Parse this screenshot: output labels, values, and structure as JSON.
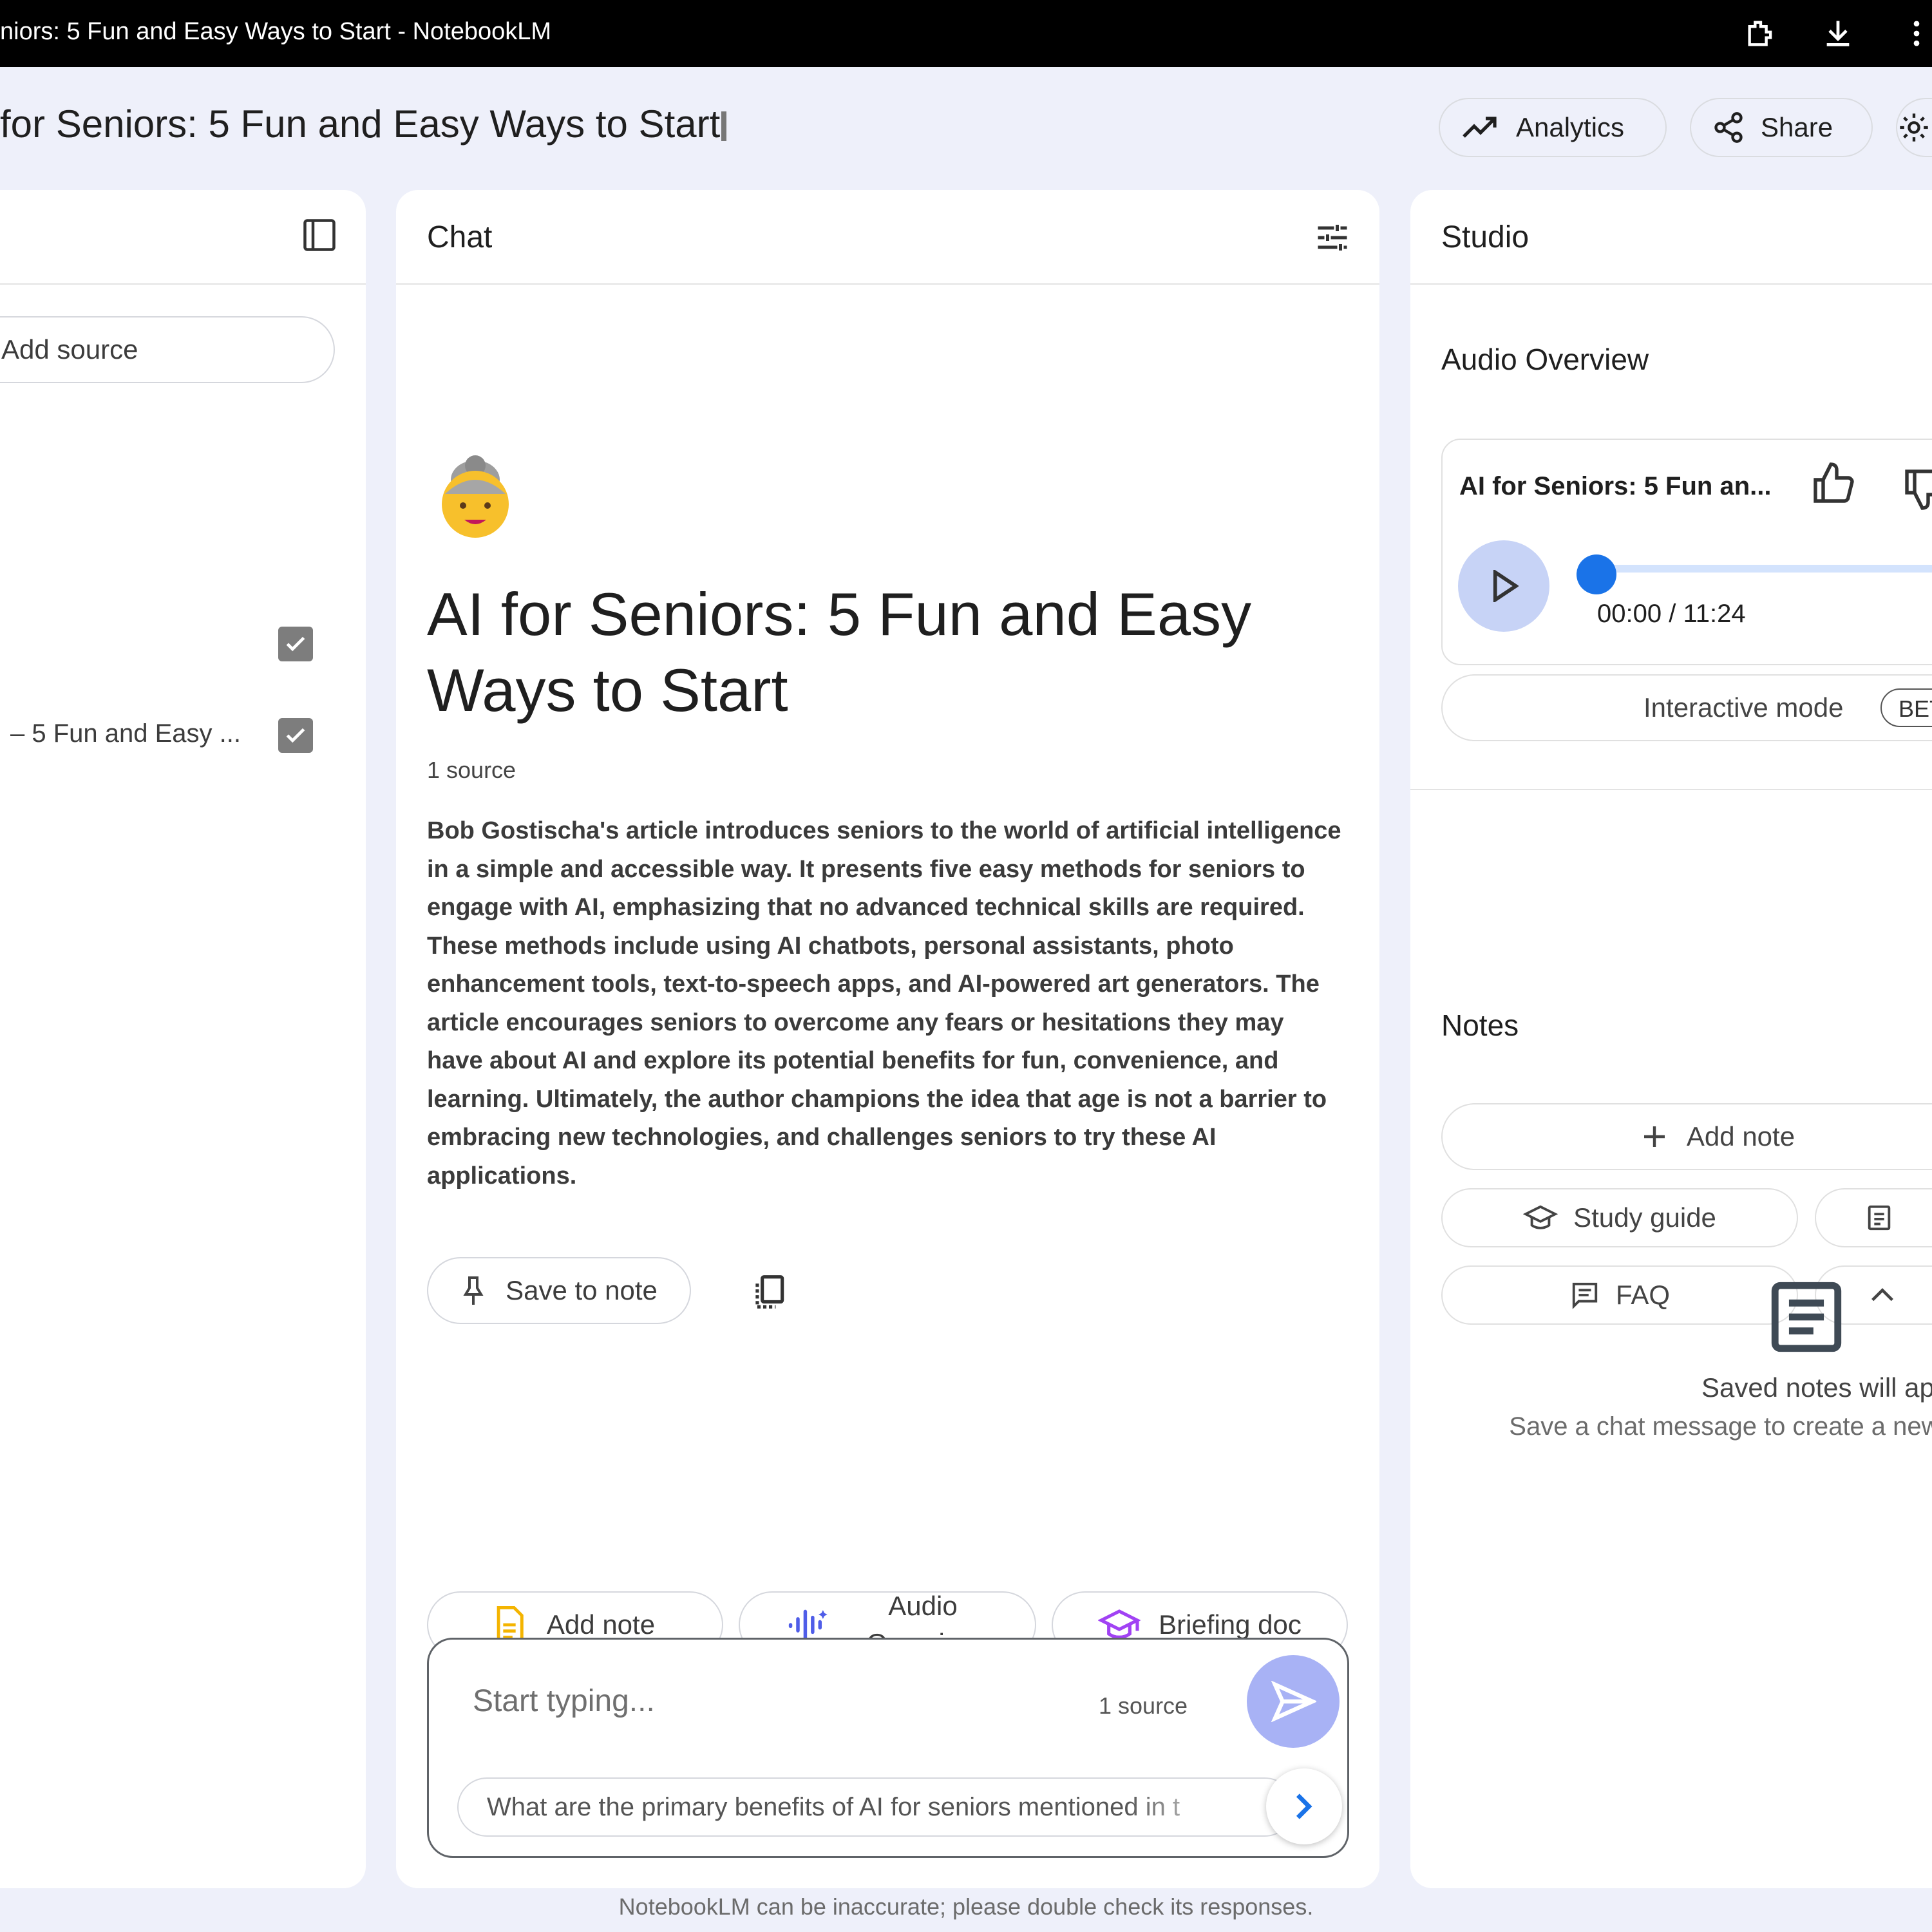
{
  "window": {
    "title": "niors: 5 Fun and Easy Ways to Start - NotebookLM"
  },
  "header": {
    "notebook_title": "for Seniors: 5 Fun and Easy Ways to Start",
    "analytics_label": "Analytics",
    "share_label": "Share"
  },
  "sources": {
    "add_source_label": "Add source",
    "items": [
      {
        "label": "",
        "checked": true
      },
      {
        "label": "– 5 Fun and Easy ...",
        "checked": true
      }
    ]
  },
  "chat": {
    "panel_title": "Chat",
    "emoji": "👵",
    "notebook_title": "AI for Seniors: 5 Fun and Easy Ways to Start",
    "source_count": "1 source",
    "summary": "Bob Gostischa's article introduces seniors to the world of artificial intelligence in a simple and accessible way. It presents five easy methods for seniors to engage with AI, emphasizing that no advanced technical skills are required. These methods include using AI chatbots, personal assistants, photo enhancement tools, text-to-speech apps, and AI-powered art generators. The article encourages seniors to overcome any fears or hesitations they may have about AI and explore its potential benefits for fun, convenience, and learning. Ultimately, the author champions the idea that age is not a barrier to embracing new technologies, and challenges seniors to try these AI applications.",
    "save_to_note_label": "Save to note",
    "actions": [
      {
        "label": "Add note",
        "icon": "document-icon"
      },
      {
        "label": "Audio Overview",
        "icon": "waveform-icon"
      },
      {
        "label": "Briefing doc",
        "icon": "mortarboard-icon"
      }
    ],
    "input": {
      "placeholder": "Start typing...",
      "source_count": "1 source"
    },
    "suggestion": "What are the primary benefits of AI for seniors mentioned in t"
  },
  "studio": {
    "panel_title": "Studio",
    "audio_overview": {
      "section_title": "Audio Overview",
      "title": "AI for Seniors: 5 Fun an...",
      "time": "00:00 / 11:24",
      "progress": 0,
      "interactive_label": "Interactive mode",
      "beta_label": "BET"
    },
    "notes": {
      "section_title": "Notes",
      "add_note_label": "Add note",
      "study_guide_label": "Study guide",
      "faq_label": "FAQ",
      "empty_title": "Saved notes will appear",
      "empty_subtitle": "Save a chat message to create a new note above."
    }
  },
  "footer": {
    "disclaimer": "NotebookLM can be inaccurate; please double check its responses."
  },
  "colors": {
    "accent": "#1a73e8",
    "send": "#a8b2f5",
    "background": "#eef0fa"
  }
}
